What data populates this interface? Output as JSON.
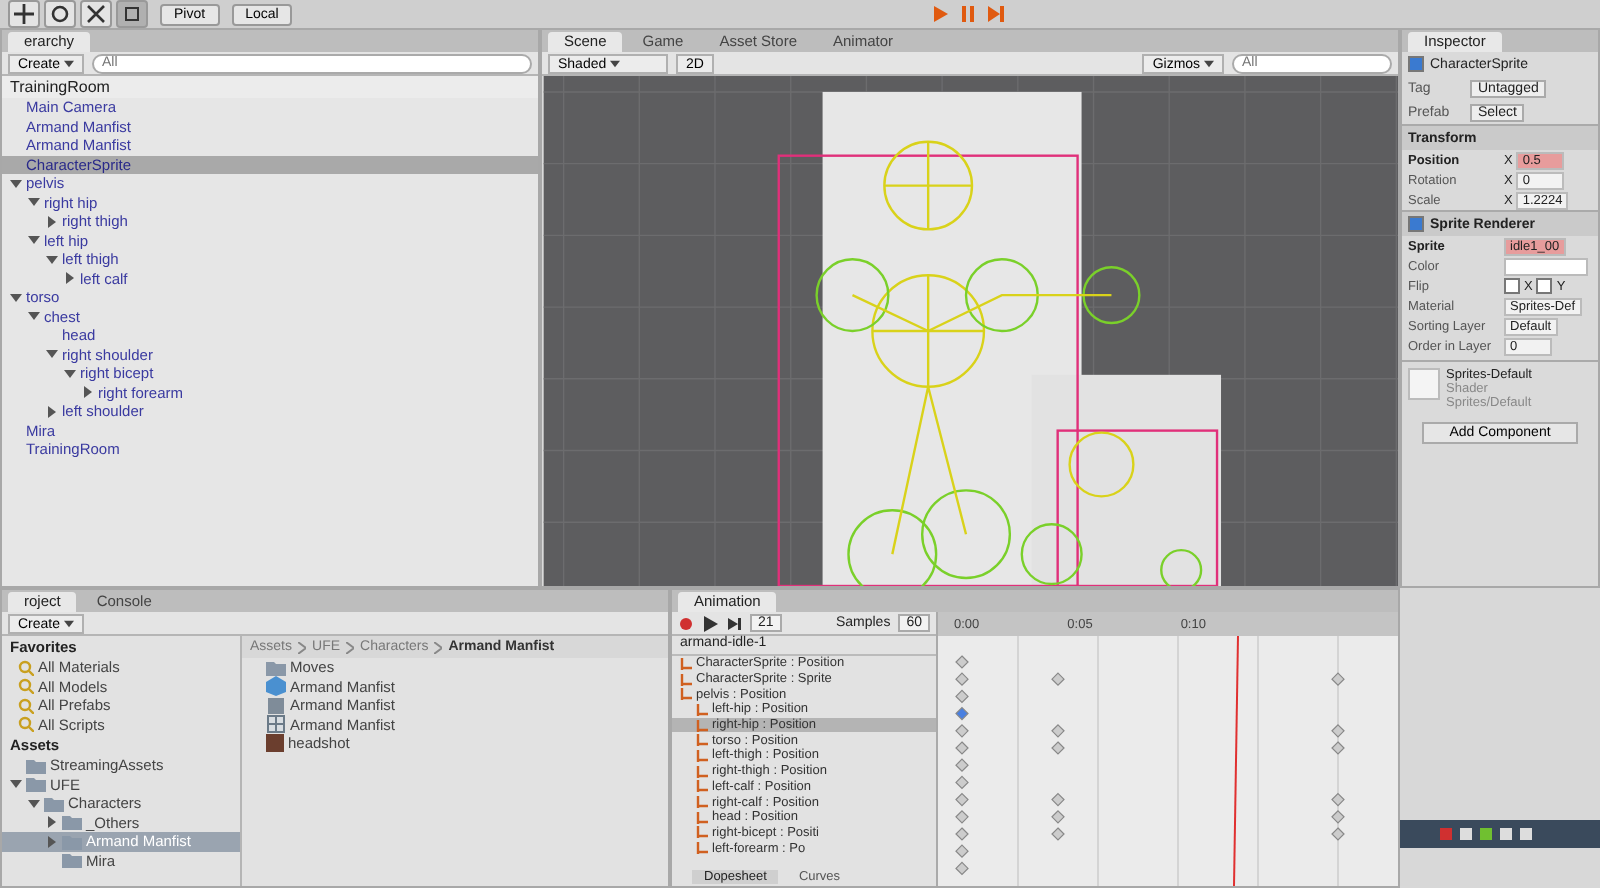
{
  "toolbar": {
    "pivot": "Pivot",
    "local": "Local"
  },
  "hierarchy": {
    "tab": "erarchy",
    "create": "Create",
    "search_placeholder": "All",
    "scene": "TrainingRoom",
    "items": [
      {
        "label": "Main Camera",
        "selected": false
      },
      {
        "label": "Armand Manfist",
        "selected": false
      },
      {
        "label": "Armand Manfist",
        "selected": false
      },
      {
        "label": "CharacterSprite",
        "selected": true
      },
      {
        "label": "pelvis",
        "selected": false,
        "expanded": true,
        "children": [
          {
            "label": "right hip",
            "selected": false,
            "expanded": true,
            "children": [
              {
                "label": "right thigh",
                "selected": false,
                "expanded": false
              }
            ]
          },
          {
            "label": "left hip",
            "selected": false,
            "expanded": true,
            "children": [
              {
                "label": "left thigh",
                "selected": false,
                "expanded": true,
                "children": [
                  {
                    "label": "left calf",
                    "selected": false,
                    "expanded": false
                  }
                ]
              }
            ]
          }
        ]
      },
      {
        "label": "torso",
        "selected": false,
        "expanded": true,
        "children": [
          {
            "label": "chest",
            "selected": false,
            "expanded": true,
            "children": [
              {
                "label": "head",
                "selected": false
              },
              {
                "label": "right shoulder",
                "selected": false,
                "expanded": true,
                "children": [
                  {
                    "label": "right bicept",
                    "selected": false,
                    "expanded": true,
                    "children": [
                      {
                        "label": "right forearm",
                        "selected": false,
                        "expanded": false
                      }
                    ]
                  }
                ]
              },
              {
                "label": "left shoulder",
                "selected": false,
                "expanded": false
              }
            ]
          }
        ]
      },
      {
        "label": "Mira",
        "selected": false
      },
      {
        "label": "TrainingRoom",
        "selected": false
      }
    ]
  },
  "scene": {
    "tabs": [
      {
        "label": "Scene",
        "selected": true
      },
      {
        "label": "Game",
        "selected": false
      },
      {
        "label": "Asset Store",
        "selected": false
      },
      {
        "label": "Animator",
        "selected": false
      }
    ],
    "shading": "Shaded",
    "mode_2d": "2D",
    "gizmos": "Gizmos",
    "search_placeholder": "All"
  },
  "inspector": {
    "tab": "Inspector",
    "object_name": "CharacterSprite",
    "active": true,
    "tag_label": "Tag",
    "tag": "Untagged",
    "prefab_label": "Prefab",
    "prefab_button": "Select",
    "components": [
      {
        "title": "Transform",
        "fields": [
          {
            "label": "Position",
            "kind": "vector",
            "axis": "X",
            "value": "0.5",
            "animated": true
          },
          {
            "label": "Rotation",
            "kind": "vector",
            "axis": "X",
            "value": "0",
            "animated": false
          },
          {
            "label": "Scale",
            "kind": "vector",
            "axis": "X",
            "value": "1.2224",
            "animated": false
          }
        ]
      },
      {
        "title": "Sprite Renderer",
        "enabled": true,
        "fields": [
          {
            "label": "Sprite",
            "kind": "text",
            "value": "idle1_00",
            "animated": true
          },
          {
            "label": "Color",
            "kind": "color",
            "animated": false
          },
          {
            "label": "Flip",
            "kind": "flags",
            "flags": [
              {
                "label": "X",
                "checked": false
              },
              {
                "label": "Y",
                "checked": false
              }
            ],
            "animated": false
          },
          {
            "label": "Material",
            "kind": "text",
            "value": "Sprites-Def",
            "animated": false
          },
          {
            "label": "Sorting Layer",
            "kind": "text",
            "value": "Default",
            "animated": false
          },
          {
            "label": "Order in Layer",
            "kind": "text",
            "value": "0",
            "animated": false
          }
        ]
      }
    ],
    "material": {
      "name": "Sprites-Default",
      "shader_label": "Shader",
      "shader": "Sprites/Default"
    },
    "add_component": "Add Component"
  },
  "project": {
    "tabs": [
      {
        "label": "roject",
        "selected": true
      },
      {
        "label": "Console",
        "selected": false
      }
    ],
    "create": "Create",
    "favorites_title": "Favorites",
    "favorites": [
      "All Materials",
      "All Models",
      "All Prefabs",
      "All Scripts"
    ],
    "assets_title": "Assets",
    "folders": [
      {
        "label": "StreamingAssets",
        "selected": false
      },
      {
        "label": "UFE",
        "selected": false,
        "expanded": true,
        "children": [
          {
            "label": "Characters",
            "selected": false,
            "expanded": true,
            "children": [
              {
                "label": "_Others",
                "selected": false,
                "expanded": false
              },
              {
                "label": "Armand Manfist",
                "selected": true,
                "expanded": false
              },
              {
                "label": "Mira",
                "selected": false
              }
            ]
          }
        ]
      }
    ],
    "breadcrumb": [
      "Assets",
      "UFE",
      "Characters",
      "Armand Manfist"
    ],
    "files": [
      {
        "label": "Moves",
        "kind": "folder"
      },
      {
        "label": "Armand Manfist",
        "kind": "prefab"
      },
      {
        "label": "Armand Manfist",
        "kind": "asset"
      },
      {
        "label": "Armand Manfist",
        "kind": "sprite"
      },
      {
        "label": "headshot",
        "kind": "image"
      }
    ]
  },
  "animation": {
    "tab": "Animation",
    "frame": "21",
    "samples_label": "Samples",
    "samples": "60",
    "clip": "armand-idle-1",
    "ticks": [
      "0:00",
      "0:05",
      "0:10"
    ],
    "properties": [
      {
        "label": "CharacterSprite : Position",
        "selected": false,
        "indent": false
      },
      {
        "label": "CharacterSprite : Sprite",
        "selected": false,
        "indent": false
      },
      {
        "label": "pelvis : Position",
        "selected": false,
        "indent": false
      },
      {
        "label": "left-hip : Position",
        "selected": false,
        "indent": true
      },
      {
        "label": "right-hip : Position",
        "selected": true,
        "indent": true
      },
      {
        "label": "torso : Position",
        "selected": false,
        "indent": true
      },
      {
        "label": "left-thigh : Position",
        "selected": false,
        "indent": true
      },
      {
        "label": "right-thigh : Position",
        "selected": false,
        "indent": true
      },
      {
        "label": "left-calf : Position",
        "selected": false,
        "indent": true
      },
      {
        "label": "right-calf : Position",
        "selected": false,
        "indent": true
      },
      {
        "label": "head : Position",
        "selected": false,
        "indent": true
      },
      {
        "label": "right-bicept : Positi",
        "selected": false,
        "indent": true
      },
      {
        "label": "left-forearm : Po",
        "selected": false,
        "indent": true
      }
    ],
    "views": [
      {
        "label": "Dopesheet",
        "selected": true
      },
      {
        "label": "Curves",
        "selected": false
      }
    ]
  }
}
